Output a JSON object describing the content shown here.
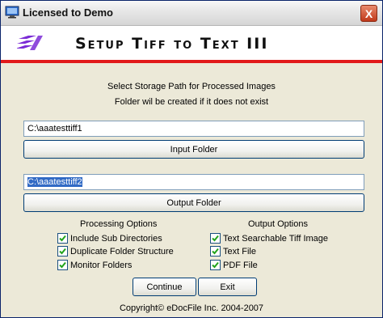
{
  "window": {
    "title": "Licensed to Demo",
    "close_label": "X"
  },
  "banner": {
    "title": "Setup Tiff to Text III"
  },
  "info": {
    "line1": "Select Storage Path for Processed Images",
    "line2": "Folder wil be created if it does not exist"
  },
  "input_folder": {
    "value": "C:\\aaatesttiff1",
    "button_label": "Input Folder"
  },
  "output_folder": {
    "value": "C:\\aaatesttiff2",
    "button_label": "Output Folder"
  },
  "processing_options": {
    "heading": "Processing Options",
    "items": [
      {
        "label": "Include Sub Directories",
        "checked": true
      },
      {
        "label": "Duplicate Folder Structure",
        "checked": true
      },
      {
        "label": "Monitor Folders",
        "checked": true
      }
    ]
  },
  "output_options": {
    "heading": "Output Options",
    "items": [
      {
        "label": "Text Searchable Tiff Image",
        "checked": true
      },
      {
        "label": "Text File",
        "checked": true
      },
      {
        "label": "PDF File",
        "checked": true
      }
    ]
  },
  "actions": {
    "continue_label": "Continue",
    "exit_label": "Exit"
  },
  "footer": {
    "copyright": "Copyright© eDocFile Inc. 2004-2007"
  },
  "colors": {
    "banner_accent": "#e21a1a",
    "logo": "#7b2bd6",
    "check": "#22a31b"
  }
}
